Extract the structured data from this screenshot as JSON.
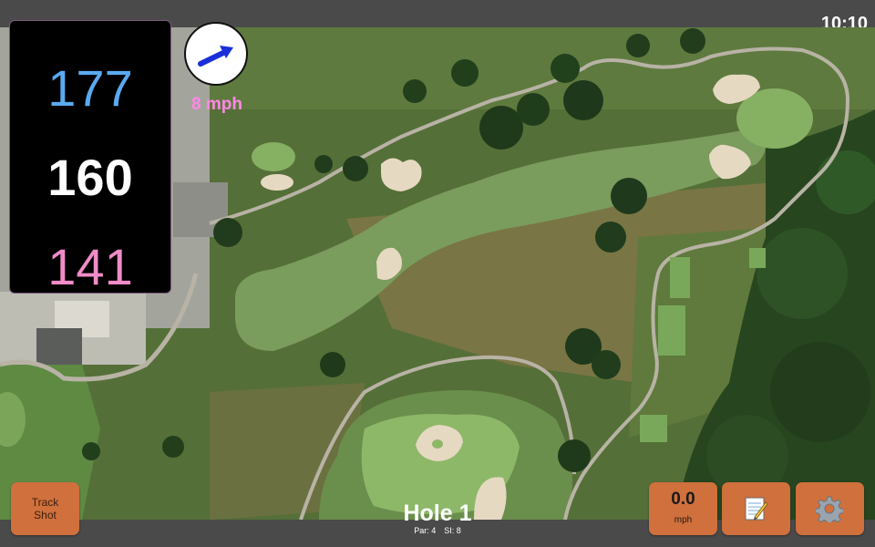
{
  "status_bar": {
    "time": "10:10"
  },
  "distances": {
    "back": "177",
    "center": "160",
    "front": "141"
  },
  "wind": {
    "speed": "8 mph",
    "icon": "wind-direction-arrow-icon"
  },
  "buttons": {
    "track_shot": "Track Shot",
    "speed_value": "0.0",
    "speed_unit": "mph",
    "notes_icon": "notepad-icon",
    "settings_icon": "gear-icon"
  },
  "hole": {
    "title": "Hole 1",
    "par": "Par: 4",
    "stroke_index": "SI: 8"
  },
  "colors": {
    "back": "#5aaaf0",
    "center": "#ffffff",
    "front": "#f08cc8",
    "wind_text": "#ff88e6",
    "button": "#d0703c",
    "bar": "#4a4a4a"
  }
}
